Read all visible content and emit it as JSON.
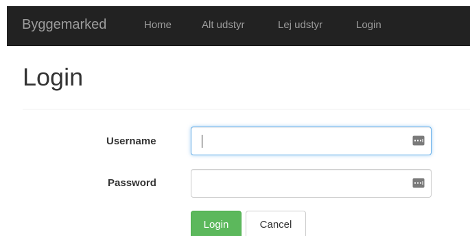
{
  "navbar": {
    "brand": "Byggemarked",
    "links": [
      {
        "label": "Home"
      },
      {
        "label": "Alt udstyr"
      },
      {
        "label": "Lej udstyr"
      },
      {
        "label": "Login"
      }
    ]
  },
  "page": {
    "title": "Login"
  },
  "form": {
    "username": {
      "label": "Username",
      "value": "",
      "icon": "password-manager-icon"
    },
    "password": {
      "label": "Password",
      "value": "",
      "icon": "password-manager-icon"
    },
    "login_label": "Login",
    "cancel_label": "Cancel"
  },
  "colors": {
    "navbar_bg": "#222222",
    "nav_text": "#9d9d9d",
    "focus_border": "#66afe9",
    "success": "#5cb85c"
  }
}
